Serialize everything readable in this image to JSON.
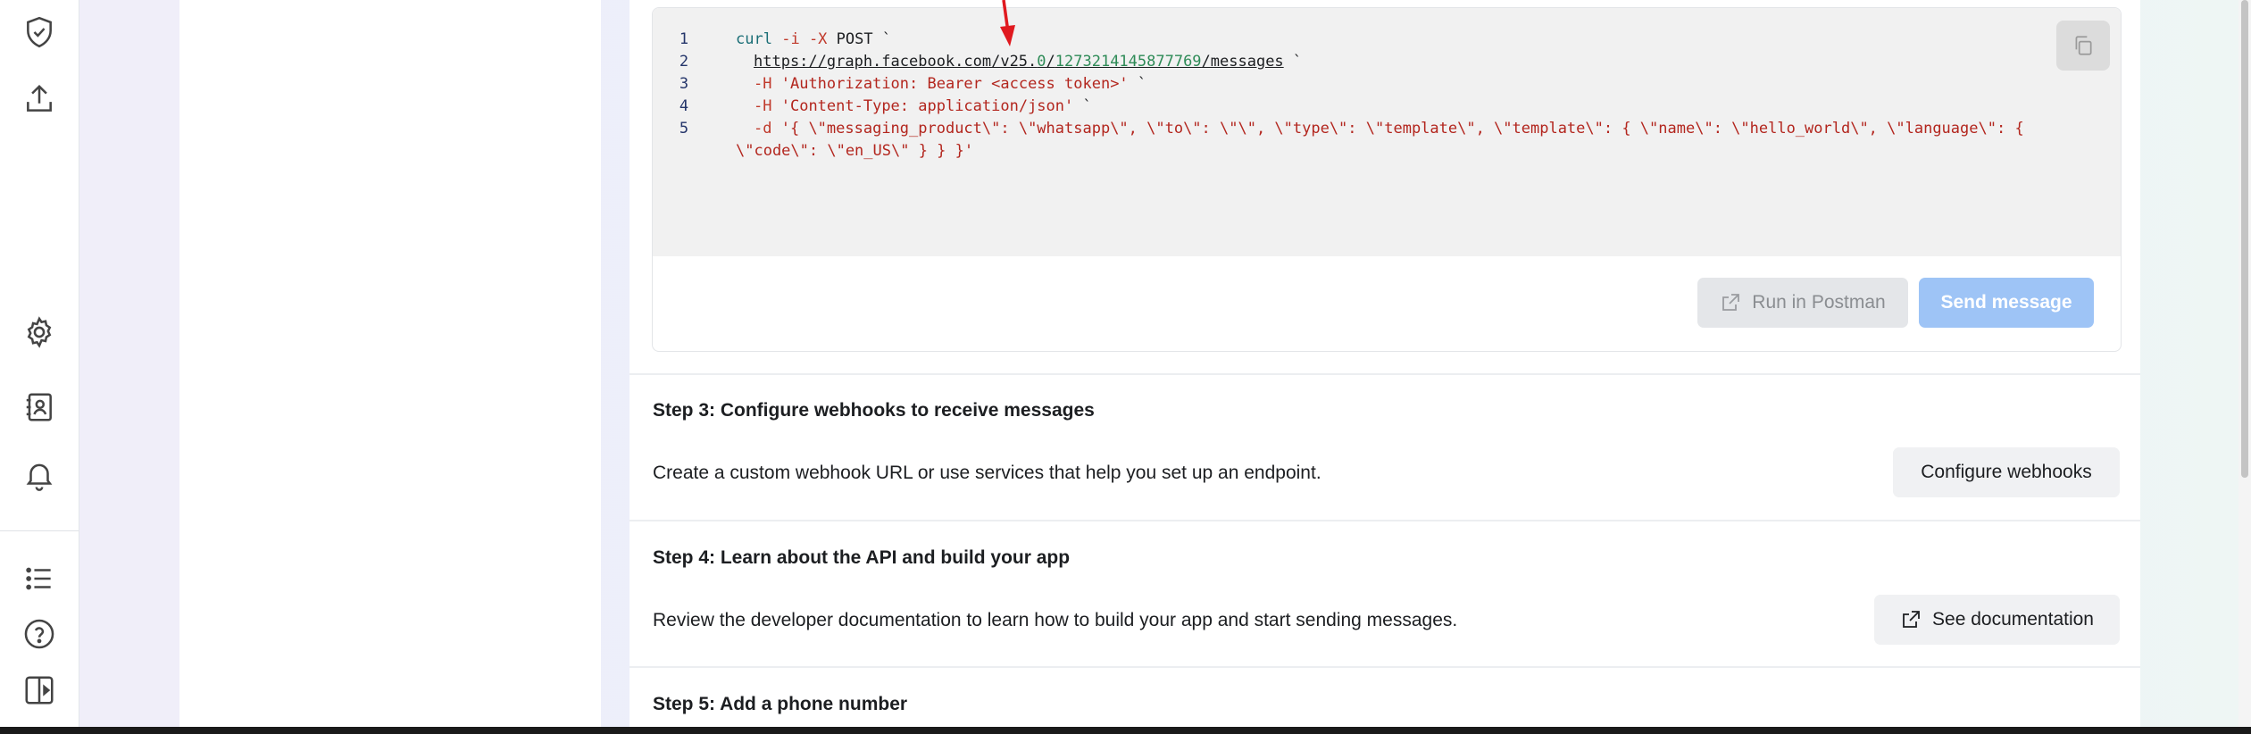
{
  "rail": {
    "icons": [
      "shield-check-icon",
      "upload-icon",
      "gear-icon",
      "contact-card-icon",
      "bell-icon",
      "list-icon",
      "help-icon",
      "sidebar-toggle-icon"
    ]
  },
  "code": {
    "line_numbers": [
      "1",
      "2",
      "3",
      "4",
      "5"
    ],
    "line1": {
      "cmd": "curl",
      "flag1": "-i",
      "flag2": "-X",
      "method": "POST `"
    },
    "line2": {
      "url_prefix": "https://graph.facebook.com/v25.",
      "version_minor": "0",
      "sep": "/",
      "phone_id": "1273214145877769",
      "suffix": "/messages",
      "tail": " `"
    },
    "line3": {
      "flag": "-H",
      "value": "'Authorization: Bearer <access token>'",
      "tail": " `"
    },
    "line4": {
      "flag": "-H",
      "value": "'Content-Type: application/json'",
      "tail": " `"
    },
    "line5": {
      "flag": "-d",
      "value": "'{ \\\"messaging_product\\\": \\\"whatsapp\\\", \\\"to\\\": \\\"\\\", \\\"type\\\": \\\"template\\\", \\\"template\\\": { \\\"name\\\": \\\"hello_world\\\", \\\"language\\\": {"
    },
    "line5_wrap": "\\\"code\\\": \\\"en_US\\\" } } }'"
  },
  "actions": {
    "run_postman": "Run in Postman",
    "send_message": "Send message"
  },
  "steps": [
    {
      "title": "Step 3: Configure webhooks to receive messages",
      "description": "Create a custom webhook URL or use services that help you set up an endpoint.",
      "button": "Configure webhooks"
    },
    {
      "title": "Step 4: Learn about the API and build your app",
      "description": "Review the developer documentation to learn how to build your app and start sending messages.",
      "button": "See documentation"
    },
    {
      "title": "Step 5: Add a phone number"
    }
  ],
  "colors": {
    "accent_arrow": "#e0191f",
    "send_button": "#9ec4f6",
    "code_bg": "#f1f1f1"
  }
}
